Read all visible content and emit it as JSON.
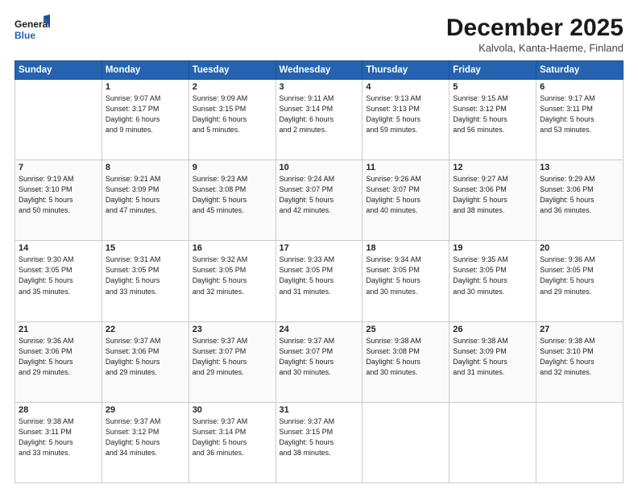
{
  "header": {
    "logo_line1": "General",
    "logo_line2": "Blue",
    "month": "December 2025",
    "location": "Kalvola, Kanta-Haeme, Finland"
  },
  "days_of_week": [
    "Sunday",
    "Monday",
    "Tuesday",
    "Wednesday",
    "Thursday",
    "Friday",
    "Saturday"
  ],
  "weeks": [
    [
      {
        "day": "",
        "info": ""
      },
      {
        "day": "1",
        "info": "Sunrise: 9:07 AM\nSunset: 3:17 PM\nDaylight: 6 hours\nand 9 minutes."
      },
      {
        "day": "2",
        "info": "Sunrise: 9:09 AM\nSunset: 3:15 PM\nDaylight: 6 hours\nand 5 minutes."
      },
      {
        "day": "3",
        "info": "Sunrise: 9:11 AM\nSunset: 3:14 PM\nDaylight: 6 hours\nand 2 minutes."
      },
      {
        "day": "4",
        "info": "Sunrise: 9:13 AM\nSunset: 3:13 PM\nDaylight: 5 hours\nand 59 minutes."
      },
      {
        "day": "5",
        "info": "Sunrise: 9:15 AM\nSunset: 3:12 PM\nDaylight: 5 hours\nand 56 minutes."
      },
      {
        "day": "6",
        "info": "Sunrise: 9:17 AM\nSunset: 3:11 PM\nDaylight: 5 hours\nand 53 minutes."
      }
    ],
    [
      {
        "day": "7",
        "info": "Sunrise: 9:19 AM\nSunset: 3:10 PM\nDaylight: 5 hours\nand 50 minutes."
      },
      {
        "day": "8",
        "info": "Sunrise: 9:21 AM\nSunset: 3:09 PM\nDaylight: 5 hours\nand 47 minutes."
      },
      {
        "day": "9",
        "info": "Sunrise: 9:23 AM\nSunset: 3:08 PM\nDaylight: 5 hours\nand 45 minutes."
      },
      {
        "day": "10",
        "info": "Sunrise: 9:24 AM\nSunset: 3:07 PM\nDaylight: 5 hours\nand 42 minutes."
      },
      {
        "day": "11",
        "info": "Sunrise: 9:26 AM\nSunset: 3:07 PM\nDaylight: 5 hours\nand 40 minutes."
      },
      {
        "day": "12",
        "info": "Sunrise: 9:27 AM\nSunset: 3:06 PM\nDaylight: 5 hours\nand 38 minutes."
      },
      {
        "day": "13",
        "info": "Sunrise: 9:29 AM\nSunset: 3:06 PM\nDaylight: 5 hours\nand 36 minutes."
      }
    ],
    [
      {
        "day": "14",
        "info": "Sunrise: 9:30 AM\nSunset: 3:05 PM\nDaylight: 5 hours\nand 35 minutes."
      },
      {
        "day": "15",
        "info": "Sunrise: 9:31 AM\nSunset: 3:05 PM\nDaylight: 5 hours\nand 33 minutes."
      },
      {
        "day": "16",
        "info": "Sunrise: 9:32 AM\nSunset: 3:05 PM\nDaylight: 5 hours\nand 32 minutes."
      },
      {
        "day": "17",
        "info": "Sunrise: 9:33 AM\nSunset: 3:05 PM\nDaylight: 5 hours\nand 31 minutes."
      },
      {
        "day": "18",
        "info": "Sunrise: 9:34 AM\nSunset: 3:05 PM\nDaylight: 5 hours\nand 30 minutes."
      },
      {
        "day": "19",
        "info": "Sunrise: 9:35 AM\nSunset: 3:05 PM\nDaylight: 5 hours\nand 30 minutes."
      },
      {
        "day": "20",
        "info": "Sunrise: 9:36 AM\nSunset: 3:05 PM\nDaylight: 5 hours\nand 29 minutes."
      }
    ],
    [
      {
        "day": "21",
        "info": "Sunrise: 9:36 AM\nSunset: 3:06 PM\nDaylight: 5 hours\nand 29 minutes."
      },
      {
        "day": "22",
        "info": "Sunrise: 9:37 AM\nSunset: 3:06 PM\nDaylight: 5 hours\nand 29 minutes."
      },
      {
        "day": "23",
        "info": "Sunrise: 9:37 AM\nSunset: 3:07 PM\nDaylight: 5 hours\nand 29 minutes."
      },
      {
        "day": "24",
        "info": "Sunrise: 9:37 AM\nSunset: 3:07 PM\nDaylight: 5 hours\nand 30 minutes."
      },
      {
        "day": "25",
        "info": "Sunrise: 9:38 AM\nSunset: 3:08 PM\nDaylight: 5 hours\nand 30 minutes."
      },
      {
        "day": "26",
        "info": "Sunrise: 9:38 AM\nSunset: 3:09 PM\nDaylight: 5 hours\nand 31 minutes."
      },
      {
        "day": "27",
        "info": "Sunrise: 9:38 AM\nSunset: 3:10 PM\nDaylight: 5 hours\nand 32 minutes."
      }
    ],
    [
      {
        "day": "28",
        "info": "Sunrise: 9:38 AM\nSunset: 3:11 PM\nDaylight: 5 hours\nand 33 minutes."
      },
      {
        "day": "29",
        "info": "Sunrise: 9:37 AM\nSunset: 3:12 PM\nDaylight: 5 hours\nand 34 minutes."
      },
      {
        "day": "30",
        "info": "Sunrise: 9:37 AM\nSunset: 3:14 PM\nDaylight: 5 hours\nand 36 minutes."
      },
      {
        "day": "31",
        "info": "Sunrise: 9:37 AM\nSunset: 3:15 PM\nDaylight: 5 hours\nand 38 minutes."
      },
      {
        "day": "",
        "info": ""
      },
      {
        "day": "",
        "info": ""
      },
      {
        "day": "",
        "info": ""
      }
    ]
  ]
}
